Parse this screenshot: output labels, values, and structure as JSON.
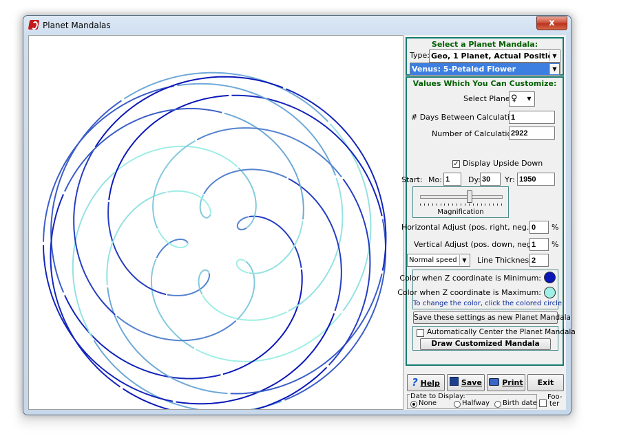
{
  "window": {
    "title": "Planet Mandalas",
    "close_label": "x"
  },
  "select_panel": {
    "header": "Select a Planet Mandala:",
    "type_label": "Type:",
    "type_value": "Geo,  1 Planet,  Actual Position",
    "mandala_value": "Venus: 5-Petaled Flower"
  },
  "custom_panel": {
    "header": "Values Which You Can Customize:",
    "select_planet_label": "Select Planet:",
    "planet_symbol": "♀",
    "days_label": "# Days Between Calculations:",
    "days_value": "1",
    "calc_label": "Number of Calculations:",
    "calc_value": "2922",
    "upside_down_label": "Display Upside Down",
    "start_label": "Start:",
    "mo_label": "Mo:",
    "mo_value": "1",
    "dy_label": "Dy:",
    "dy_value": "30",
    "yr_label": "Yr:",
    "yr_value": "1950",
    "magnification_label": "Magnification",
    "magnification_level": 0.6,
    "h_adjust_label": "Horizontal Adjust (pos. right,  neg. left)",
    "h_adjust_value": "0",
    "v_adjust_label": "Vertical Adjust (pos. down,  neg. up)",
    "v_adjust_value": "1",
    "percent": "%",
    "speed_value": "Normal speed",
    "thickness_label": "Line Thickness:",
    "thickness_value": "2",
    "color_min_label": "Color when Z coordinate is Minimum:",
    "color_max_label": "Color when Z coordinate is Maximum:",
    "color_hint": "To change the color, click the colored circle",
    "color_min": "#0a16b8",
    "color_max": "#9ff0e6",
    "save_settings_label": "Save these settings as new Planet Mandala",
    "auto_center_label": "Automatically Center the Planet Mandala",
    "draw_label": "Draw Customized Mandala"
  },
  "bottom": {
    "help_label": "Help",
    "save_label": "Save",
    "print_label": "Print",
    "exit_label": "Exit",
    "date_group_label": "Date to Display:",
    "none_label": "None",
    "halfway_label": "Halfway",
    "birth_label": "Birth date",
    "footer_label_1": "Foo-",
    "footer_label_2": "ter"
  }
}
